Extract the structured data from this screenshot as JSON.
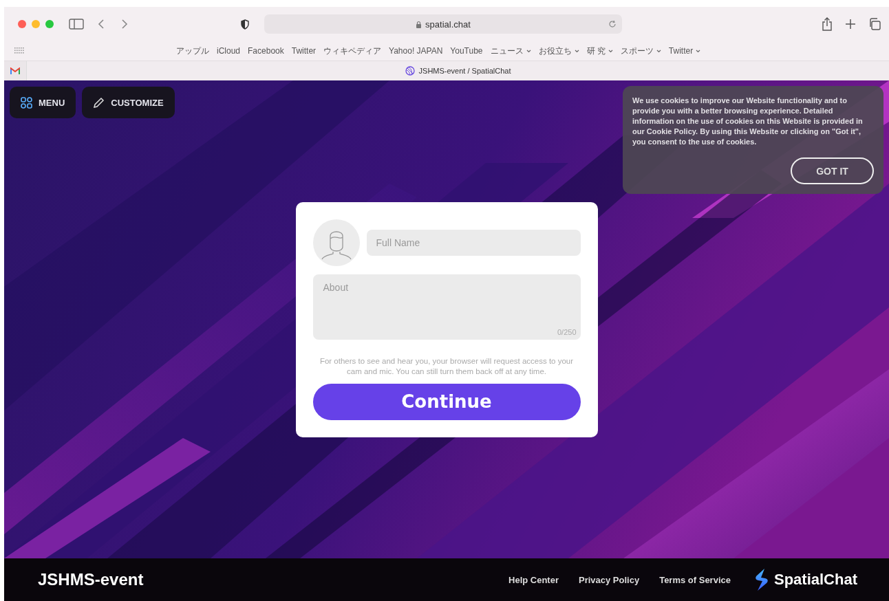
{
  "browser": {
    "address": "spatial.chat",
    "tab_title": "JSHMS-event / SpatialChat",
    "bookmarks": [
      {
        "label": "アップル",
        "menu": false
      },
      {
        "label": "iCloud",
        "menu": false
      },
      {
        "label": "Facebook",
        "menu": false
      },
      {
        "label": "Twitter",
        "menu": false
      },
      {
        "label": "ウィキペディア",
        "menu": false
      },
      {
        "label": "Yahoo! JAPAN",
        "menu": false
      },
      {
        "label": "YouTube",
        "menu": false
      },
      {
        "label": "ニュース",
        "menu": true
      },
      {
        "label": "お役立ち",
        "menu": true
      },
      {
        "label": "研 究",
        "menu": true
      },
      {
        "label": "スポーツ",
        "menu": true
      },
      {
        "label": "Twitter",
        "menu": true
      }
    ]
  },
  "top_buttons": [
    {
      "kind": "menu",
      "label": "MENU"
    },
    {
      "kind": "customize",
      "label": "CUSTOMIZE"
    }
  ],
  "cookie_notice": {
    "text": "We use cookies to improve our Website functionality and to provide you with a better browsing experience. Detailed information on the use of cookies on this Website is provided in our Cookie Policy. By using this Website or clicking on \"Got it\", you consent to the use of cookies.",
    "button": "GOT IT"
  },
  "profile_form": {
    "name_placeholder": "Full Name",
    "about_placeholder": "About",
    "counter": "0/250",
    "notice": "For others to see and hear you, your browser will request access to your cam and mic. You can still turn them back off at any time.",
    "button": "Continue"
  },
  "footer": {
    "event_name": "JSHMS-event",
    "links": [
      "Help Center",
      "Privacy Policy",
      "Terms of Service"
    ],
    "brand": "SpatialChat"
  }
}
